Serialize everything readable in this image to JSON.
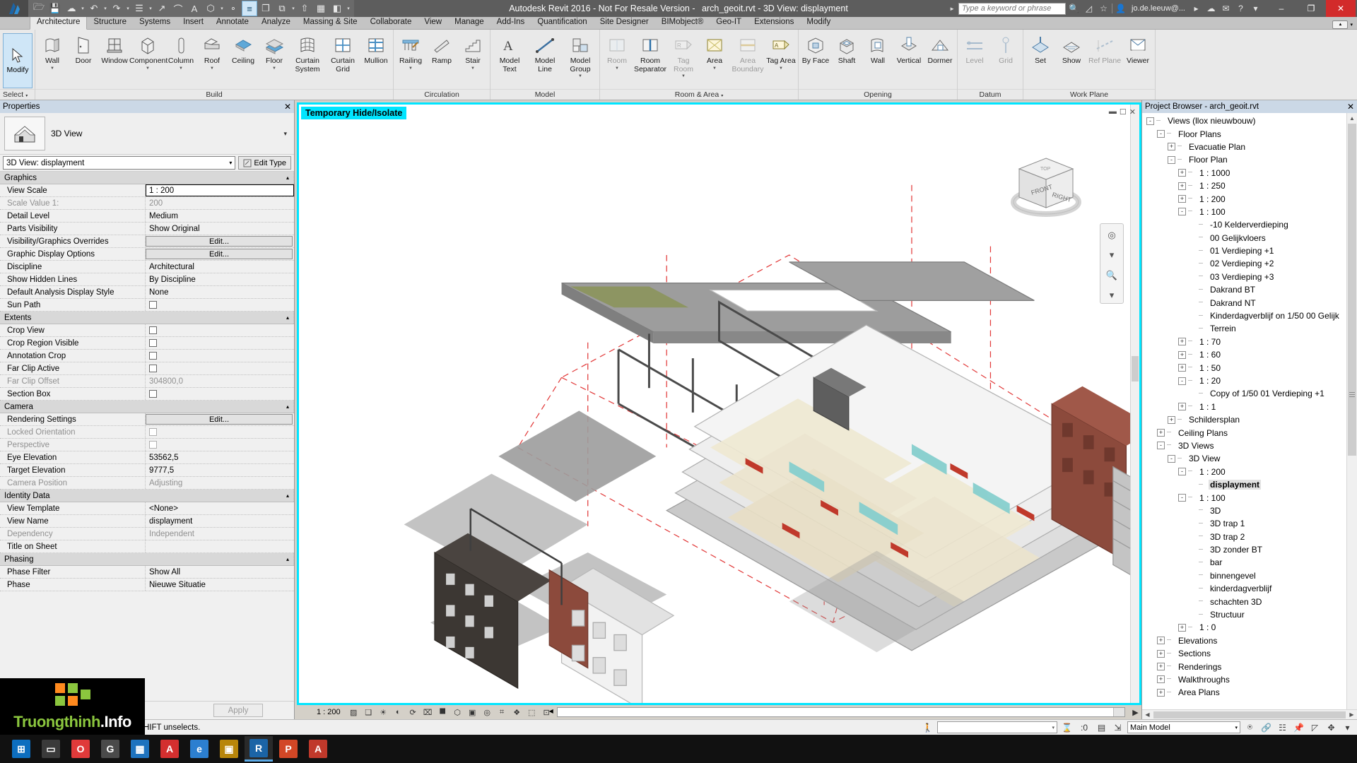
{
  "titlebar": {
    "app_title_prefix": "Autodesk Revit 2016 - Not For Resale Version -",
    "doc_title": "arch_geoit.rvt - 3D View: displayment",
    "search_placeholder": "Type a keyword or phrase",
    "account": "jo.de.leeuw@...",
    "quick_access": [
      {
        "name": "open-icon",
        "glyph": "🗁"
      },
      {
        "name": "save-icon",
        "glyph": "💾"
      },
      {
        "name": "cloud-sync-icon",
        "glyph": "☁"
      },
      {
        "name": "undo-icon",
        "glyph": "↶"
      },
      {
        "name": "redo-icon",
        "glyph": "↷"
      },
      {
        "name": "print-icon",
        "glyph": "☰"
      },
      {
        "name": "measure-icon",
        "glyph": "↗"
      },
      {
        "name": "dimension-icon",
        "glyph": "⌒"
      },
      {
        "name": "text-icon",
        "glyph": "A"
      },
      {
        "name": "default-3d-view-icon",
        "glyph": "⬡"
      },
      {
        "name": "section-icon",
        "glyph": "∘"
      },
      {
        "name": "thin-lines-icon",
        "glyph": "≡"
      },
      {
        "name": "close-hidden-windows-icon",
        "glyph": "❐"
      },
      {
        "name": "switch-windows-icon",
        "glyph": "⧉"
      },
      {
        "name": "new-icon",
        "glyph": "⇧"
      },
      {
        "name": "grid-icon",
        "glyph": "▦"
      },
      {
        "name": "tile-icon",
        "glyph": "◧"
      }
    ],
    "window_buttons": {
      "minimize": "–",
      "maximize": "❐",
      "close": "✕"
    }
  },
  "ribbon": {
    "tabs": [
      "Architecture",
      "Structure",
      "Systems",
      "Insert",
      "Annotate",
      "Analyze",
      "Massing & Site",
      "Collaborate",
      "View",
      "Manage",
      "Add-Ins",
      "Quantification",
      "Site Designer",
      "BIMobject®",
      "Geo-IT",
      "Extensions",
      "Modify"
    ],
    "active_tab": "Architecture",
    "select_panel": {
      "button": "Modify",
      "label": "Select"
    },
    "panels": [
      {
        "name": "Build",
        "buttons": [
          {
            "label": "Wall",
            "icon": "wall-icon",
            "dropdown": true
          },
          {
            "label": "Door",
            "icon": "door-icon",
            "dropdown": false
          },
          {
            "label": "Window",
            "icon": "window-icon",
            "dropdown": false
          },
          {
            "label": "Component",
            "icon": "component-icon",
            "dropdown": true
          },
          {
            "label": "Column",
            "icon": "column-icon",
            "dropdown": true
          },
          {
            "label": "Roof",
            "icon": "roof-icon",
            "dropdown": true
          },
          {
            "label": "Ceiling",
            "icon": "ceiling-icon",
            "dropdown": false
          },
          {
            "label": "Floor",
            "icon": "floor-icon",
            "dropdown": true
          },
          {
            "label": "Curtain System",
            "icon": "curtain-system-icon",
            "dropdown": false
          },
          {
            "label": "Curtain Grid",
            "icon": "curtain-grid-icon",
            "dropdown": false
          },
          {
            "label": "Mullion",
            "icon": "mullion-icon",
            "dropdown": false
          }
        ]
      },
      {
        "name": "Circulation",
        "buttons": [
          {
            "label": "Railing",
            "icon": "railing-icon",
            "dropdown": true
          },
          {
            "label": "Ramp",
            "icon": "ramp-icon",
            "dropdown": false
          },
          {
            "label": "Stair",
            "icon": "stair-icon",
            "dropdown": true
          }
        ]
      },
      {
        "name": "Model",
        "buttons": [
          {
            "label": "Model Text",
            "icon": "model-text-icon",
            "dropdown": false
          },
          {
            "label": "Model Line",
            "icon": "model-line-icon",
            "dropdown": false
          },
          {
            "label": "Model Group",
            "icon": "model-group-icon",
            "dropdown": true
          }
        ]
      },
      {
        "name": "Room & Area",
        "dropdown": true,
        "buttons": [
          {
            "label": "Room",
            "icon": "room-icon",
            "dropdown": true,
            "dim": true
          },
          {
            "label": "Room Separator",
            "icon": "room-separator-icon",
            "dropdown": false
          },
          {
            "label": "Tag Room",
            "icon": "tag-room-icon",
            "dropdown": true,
            "dim": true
          },
          {
            "label": "Area",
            "icon": "area-icon",
            "dropdown": true
          },
          {
            "label": "Area Boundary",
            "icon": "area-boundary-icon",
            "dropdown": false,
            "dim": true
          },
          {
            "label": "Tag Area",
            "icon": "tag-area-icon",
            "dropdown": true
          }
        ]
      },
      {
        "name": "Opening",
        "buttons": [
          {
            "label": "By Face",
            "icon": "by-face-icon",
            "dropdown": false
          },
          {
            "label": "Shaft",
            "icon": "shaft-icon",
            "dropdown": false
          },
          {
            "label": "Wall",
            "icon": "wall-opening-icon",
            "dropdown": false
          },
          {
            "label": "Vertical",
            "icon": "vertical-opening-icon",
            "dropdown": false
          },
          {
            "label": "Dormer",
            "icon": "dormer-opening-icon",
            "dropdown": false
          }
        ]
      },
      {
        "name": "Datum",
        "buttons": [
          {
            "label": "Level",
            "icon": "level-icon",
            "dropdown": false,
            "dim": true
          },
          {
            "label": "Grid",
            "icon": "grid-datum-icon",
            "dropdown": false,
            "dim": true
          }
        ]
      },
      {
        "name": "Work Plane",
        "buttons": [
          {
            "label": "Set",
            "icon": "set-workplane-icon",
            "dropdown": false
          },
          {
            "label": "Show",
            "icon": "show-workplane-icon",
            "dropdown": false
          },
          {
            "label": "Ref Plane",
            "icon": "ref-plane-icon",
            "dropdown": false,
            "dim": true
          },
          {
            "label": "Viewer",
            "icon": "workplane-viewer-icon",
            "dropdown": false
          }
        ]
      }
    ]
  },
  "properties": {
    "title": "Properties",
    "close_icon": "✕",
    "type_label": "3D View",
    "family_value": "3D View: displayment",
    "edit_type_label": "Edit Type",
    "apply_label": "Apply",
    "groups": [
      {
        "name": "Graphics",
        "rows": [
          {
            "key": "View Scale",
            "value": "1 : 200",
            "kind": "text",
            "boxed": true
          },
          {
            "key": "Scale Value    1:",
            "value": "200",
            "kind": "text",
            "dim": true
          },
          {
            "key": "Detail Level",
            "value": "Medium",
            "kind": "text"
          },
          {
            "key": "Parts Visibility",
            "value": "Show Original",
            "kind": "text"
          },
          {
            "key": "Visibility/Graphics Overrides",
            "value": "Edit...",
            "kind": "button"
          },
          {
            "key": "Graphic Display Options",
            "value": "Edit...",
            "kind": "button"
          },
          {
            "key": "Discipline",
            "value": "Architectural",
            "kind": "text"
          },
          {
            "key": "Show Hidden Lines",
            "value": "By Discipline",
            "kind": "text"
          },
          {
            "key": "Default Analysis Display Style",
            "value": "None",
            "kind": "text"
          },
          {
            "key": "Sun Path",
            "value": "",
            "kind": "checkbox"
          }
        ]
      },
      {
        "name": "Extents",
        "rows": [
          {
            "key": "Crop View",
            "value": "",
            "kind": "checkbox"
          },
          {
            "key": "Crop Region Visible",
            "value": "",
            "kind": "checkbox"
          },
          {
            "key": "Annotation Crop",
            "value": "",
            "kind": "checkbox"
          },
          {
            "key": "Far Clip Active",
            "value": "",
            "kind": "checkbox"
          },
          {
            "key": "Far Clip Offset",
            "value": "304800,0",
            "kind": "text",
            "dim": true
          },
          {
            "key": "Section Box",
            "value": "",
            "kind": "checkbox"
          }
        ]
      },
      {
        "name": "Camera",
        "rows": [
          {
            "key": "Rendering Settings",
            "value": "Edit...",
            "kind": "button"
          },
          {
            "key": "Locked Orientation",
            "value": "",
            "kind": "checkbox",
            "dim": true
          },
          {
            "key": "Perspective",
            "value": "",
            "kind": "checkbox",
            "dim": true
          },
          {
            "key": "Eye Elevation",
            "value": "53562,5",
            "kind": "text"
          },
          {
            "key": "Target Elevation",
            "value": "9777,5",
            "kind": "text"
          },
          {
            "key": "Camera Position",
            "value": "Adjusting",
            "kind": "text",
            "dim": true
          }
        ]
      },
      {
        "name": "Identity Data",
        "rows": [
          {
            "key": "View Template",
            "value": "<None>",
            "kind": "text"
          },
          {
            "key": "View Name",
            "value": "displayment",
            "kind": "text"
          },
          {
            "key": "Dependency",
            "value": "Independent",
            "kind": "text",
            "dim": true
          },
          {
            "key": "Title on Sheet",
            "value": "",
            "kind": "text"
          }
        ]
      },
      {
        "name": "Phasing",
        "rows": [
          {
            "key": "Phase Filter",
            "value": "Show All",
            "kind": "text"
          },
          {
            "key": "Phase",
            "value": "Nieuwe Situatie",
            "kind": "text"
          }
        ]
      }
    ]
  },
  "viewport": {
    "temporary_hide_isolate": "Temporary Hide/Isolate",
    "viewcube": {
      "front": "FRONT",
      "right": "RIGHT",
      "top": "TOP"
    },
    "controls": [
      "–",
      "❐",
      "✕"
    ],
    "navbar": [
      "⌕",
      "⌘",
      "▼"
    ]
  },
  "viewbar": {
    "scale": "1 : 200",
    "icons": [
      {
        "name": "detail-level-icon",
        "glyph": "▨"
      },
      {
        "name": "visual-style-icon",
        "glyph": "❑"
      },
      {
        "name": "sun-path-icon",
        "glyph": "☀"
      },
      {
        "name": "shadows-icon",
        "glyph": "◐"
      },
      {
        "name": "rendering-display-icon",
        "glyph": "⟳"
      },
      {
        "name": "crop-view-icon",
        "glyph": "⌧"
      },
      {
        "name": "show-crop-region-icon",
        "glyph": "⯀"
      },
      {
        "name": "lock-3d-view-icon",
        "glyph": "⬡"
      },
      {
        "name": "temporary-hide-isolate-icon",
        "glyph": "▣"
      },
      {
        "name": "reveal-hidden-elements-icon",
        "glyph": "◎"
      },
      {
        "name": "temporary-view-properties-icon",
        "glyph": "⌗"
      },
      {
        "name": "show-analytical-model-icon",
        "glyph": "❖"
      },
      {
        "name": "highlight-displacement-sets-icon",
        "glyph": "⬚"
      },
      {
        "name": "constraints-icon",
        "glyph": "⊡"
      }
    ]
  },
  "browser": {
    "title": "Project Browser - arch_geoit.rvt",
    "close_icon": "✕",
    "nodes": [
      {
        "depth": 0,
        "label": "Views (llox nieuwbouw)",
        "exp": "-",
        "icon": true
      },
      {
        "depth": 1,
        "label": "Floor Plans",
        "exp": "-"
      },
      {
        "depth": 2,
        "label": "Evacuatie Plan",
        "exp": "+"
      },
      {
        "depth": 2,
        "label": "Floor Plan",
        "exp": "-"
      },
      {
        "depth": 3,
        "label": "1 : 1000",
        "exp": "+"
      },
      {
        "depth": 3,
        "label": "1 : 250",
        "exp": "+"
      },
      {
        "depth": 3,
        "label": "1 : 200",
        "exp": "+"
      },
      {
        "depth": 3,
        "label": "1 : 100",
        "exp": "-"
      },
      {
        "depth": 4,
        "label": "-10 Kelderverdieping",
        "exp": ""
      },
      {
        "depth": 4,
        "label": "00 Gelijkvloers",
        "exp": ""
      },
      {
        "depth": 4,
        "label": "01 Verdieping +1",
        "exp": ""
      },
      {
        "depth": 4,
        "label": "02 Verdieping +2",
        "exp": ""
      },
      {
        "depth": 4,
        "label": "03 Verdieping +3",
        "exp": ""
      },
      {
        "depth": 4,
        "label": "Dakrand BT",
        "exp": ""
      },
      {
        "depth": 4,
        "label": "Dakrand NT",
        "exp": ""
      },
      {
        "depth": 4,
        "label": "Kinderdagverblijf on 1/50 00 Gelijk",
        "exp": ""
      },
      {
        "depth": 4,
        "label": "Terrein",
        "exp": ""
      },
      {
        "depth": 3,
        "label": "1 : 70",
        "exp": "+"
      },
      {
        "depth": 3,
        "label": "1 : 60",
        "exp": "+"
      },
      {
        "depth": 3,
        "label": "1 : 50",
        "exp": "+"
      },
      {
        "depth": 3,
        "label": "1 : 20",
        "exp": "-"
      },
      {
        "depth": 4,
        "label": "Copy of 1/50 01 Verdieping +1",
        "exp": ""
      },
      {
        "depth": 3,
        "label": "1 : 1",
        "exp": "+"
      },
      {
        "depth": 2,
        "label": "Schildersplan",
        "exp": "+"
      },
      {
        "depth": 1,
        "label": "Ceiling Plans",
        "exp": "+"
      },
      {
        "depth": 1,
        "label": "3D Views",
        "exp": "-"
      },
      {
        "depth": 2,
        "label": "3D View",
        "exp": "-"
      },
      {
        "depth": 3,
        "label": "1 : 200",
        "exp": "-"
      },
      {
        "depth": 4,
        "label": "displayment",
        "exp": "",
        "selected": true
      },
      {
        "depth": 3,
        "label": "1 : 100",
        "exp": "-"
      },
      {
        "depth": 4,
        "label": "3D",
        "exp": ""
      },
      {
        "depth": 4,
        "label": "3D trap 1",
        "exp": ""
      },
      {
        "depth": 4,
        "label": "3D trap 2",
        "exp": ""
      },
      {
        "depth": 4,
        "label": "3D zonder BT",
        "exp": ""
      },
      {
        "depth": 4,
        "label": "bar",
        "exp": ""
      },
      {
        "depth": 4,
        "label": "binnengevel",
        "exp": ""
      },
      {
        "depth": 4,
        "label": "kinderdagverblijf",
        "exp": ""
      },
      {
        "depth": 4,
        "label": "schachten 3D",
        "exp": ""
      },
      {
        "depth": 4,
        "label": "Structuur",
        "exp": ""
      },
      {
        "depth": 3,
        "label": "1 : 0",
        "exp": "+"
      },
      {
        "depth": 1,
        "label": "Elevations",
        "exp": "+"
      },
      {
        "depth": 1,
        "label": "Sections",
        "exp": "+"
      },
      {
        "depth": 1,
        "label": "Renderings",
        "exp": "+"
      },
      {
        "depth": 1,
        "label": "Walkthroughs",
        "exp": "+"
      },
      {
        "depth": 1,
        "label": "Area Plans",
        "exp": "+"
      }
    ]
  },
  "statusbar": {
    "message": "adds, SHIFT unselects.",
    "filter_count": ":0",
    "model_value": "Main Model",
    "icons": [
      {
        "name": "design-options-icon",
        "glyph": "🚶"
      },
      {
        "name": "filter-icon",
        "glyph": "⧓"
      },
      {
        "name": "worksets-icon",
        "glyph": "▤"
      },
      {
        "name": "editing-requests-icon",
        "glyph": "⛶"
      },
      {
        "name": "exclude-options-icon",
        "glyph": "⬡"
      },
      {
        "name": "select-links-icon",
        "glyph": "🔗"
      },
      {
        "name": "select-pinned-icon",
        "glyph": "📌"
      },
      {
        "name": "select-by-face-icon",
        "glyph": "◰"
      },
      {
        "name": "drag-elements-icon",
        "glyph": "✥"
      },
      {
        "name": "selection-toggle-icon",
        "glyph": "▽"
      }
    ]
  },
  "taskbar": {
    "items": [
      {
        "name": "start-button",
        "glyph": "⊞"
      },
      {
        "name": "search-taskbar-icon",
        "glyph": "▭"
      },
      {
        "name": "opera-icon",
        "glyph": "O"
      },
      {
        "name": "gmail-icon",
        "glyph": "G"
      },
      {
        "name": "store-icon",
        "glyph": "▦"
      },
      {
        "name": "autodesk-a360-icon",
        "glyph": "A"
      },
      {
        "name": "edge-icon",
        "glyph": "e"
      },
      {
        "name": "explorer-icon",
        "glyph": "▣"
      },
      {
        "name": "revit-icon",
        "glyph": "R",
        "active": true
      },
      {
        "name": "powerpoint-icon",
        "glyph": "P"
      },
      {
        "name": "autocad-icon",
        "glyph": "A"
      }
    ]
  },
  "watermark": {
    "text1": "Truongthinh",
    "text2": ".Info"
  },
  "colors": {
    "accent_cyan": "#00e5ff",
    "ribbon_bg": "#e9e9e9",
    "titlebar_bg": "#5d5d5d",
    "panel_header": "#cbd8e6",
    "close_red": "#d22b2b",
    "model_brick": "#8c4a3c",
    "model_grey": "#9a9a9a"
  }
}
